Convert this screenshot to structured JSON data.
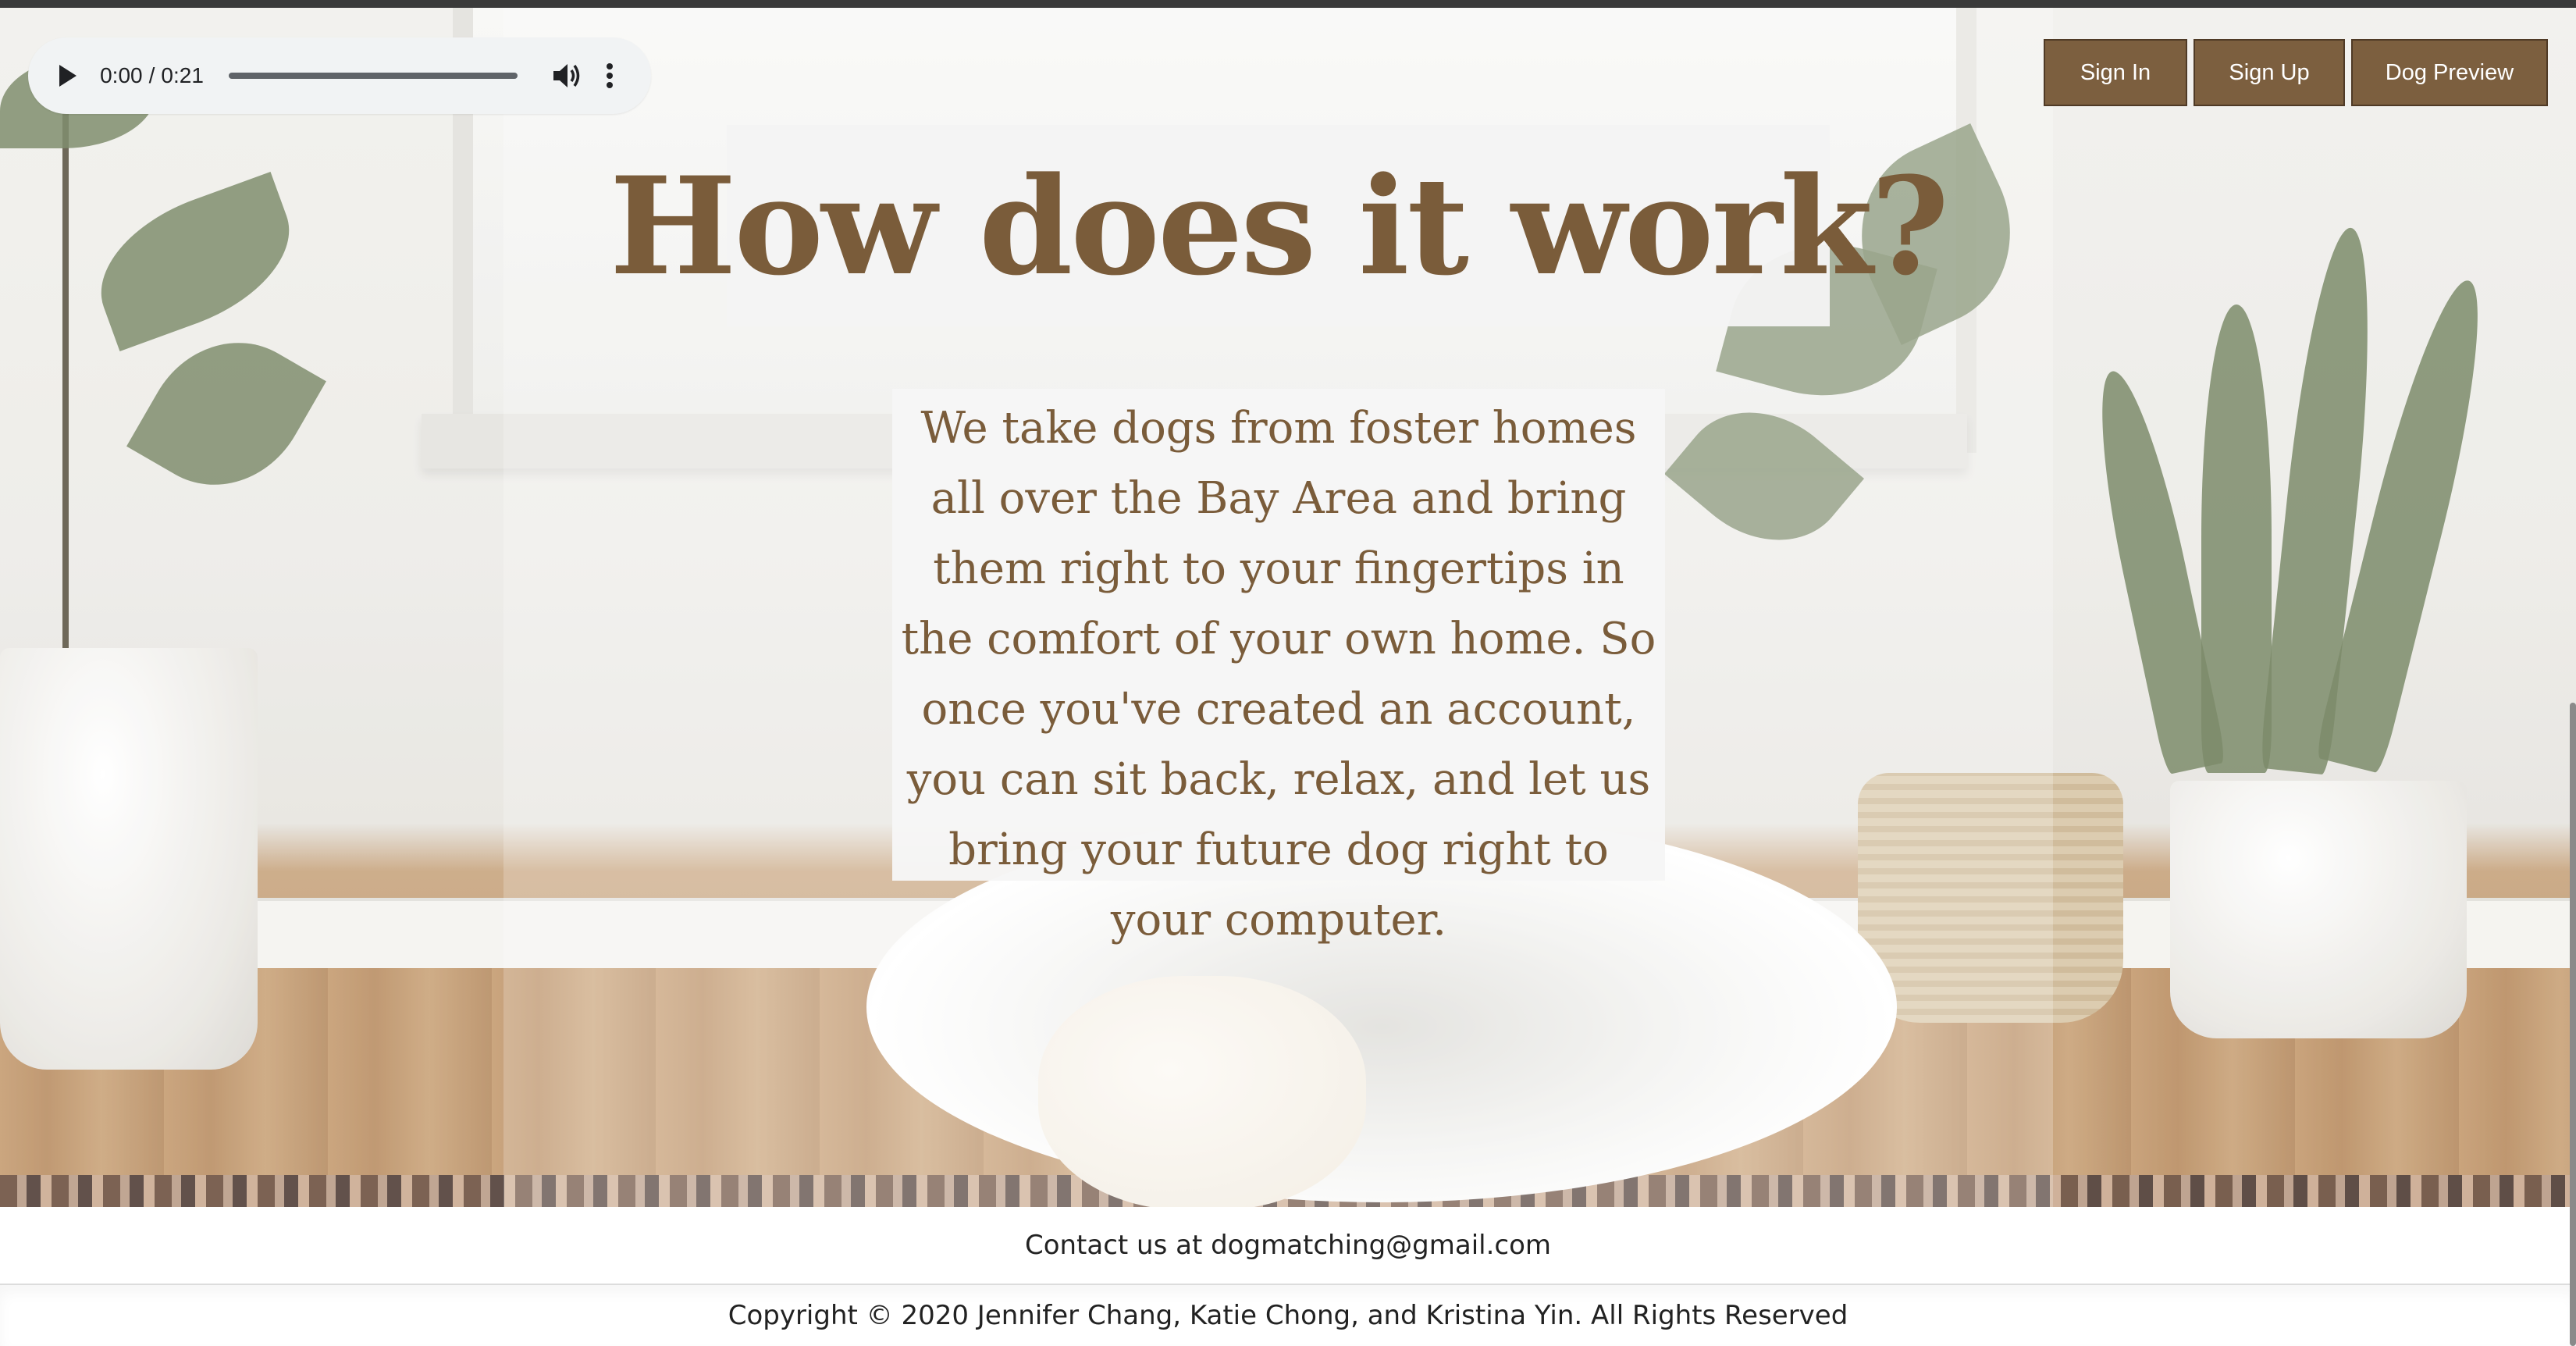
{
  "audio_player": {
    "current_time": "0:00",
    "separator": "/",
    "duration": "0:21",
    "progress": 0,
    "play_icon": "play-icon",
    "volume_icon": "volume-icon",
    "more_icon": "more-options-icon"
  },
  "nav": {
    "sign_in": "Sign In",
    "sign_up": "Sign Up",
    "dog_preview": "Dog Preview"
  },
  "hero": {
    "title": "How does it work?",
    "description": "We take dogs from foster homes all over the Bay Area and bring them right to your fingertips in the comfort of your own home. So once you've created an account, you can sit back, relax, and let us bring your future dog right to your computer."
  },
  "footer": {
    "contact": "Contact us at dogmatching@gmail.com",
    "copyright": "Copyright © 2020 Jennifer Chang, Katie Chong, and Kristina Yin. All Rights Reserved"
  },
  "colors": {
    "brand_brown": "#7c5f3f",
    "text_brown": "#7a5c3a",
    "button_border": "#4f3a26"
  }
}
